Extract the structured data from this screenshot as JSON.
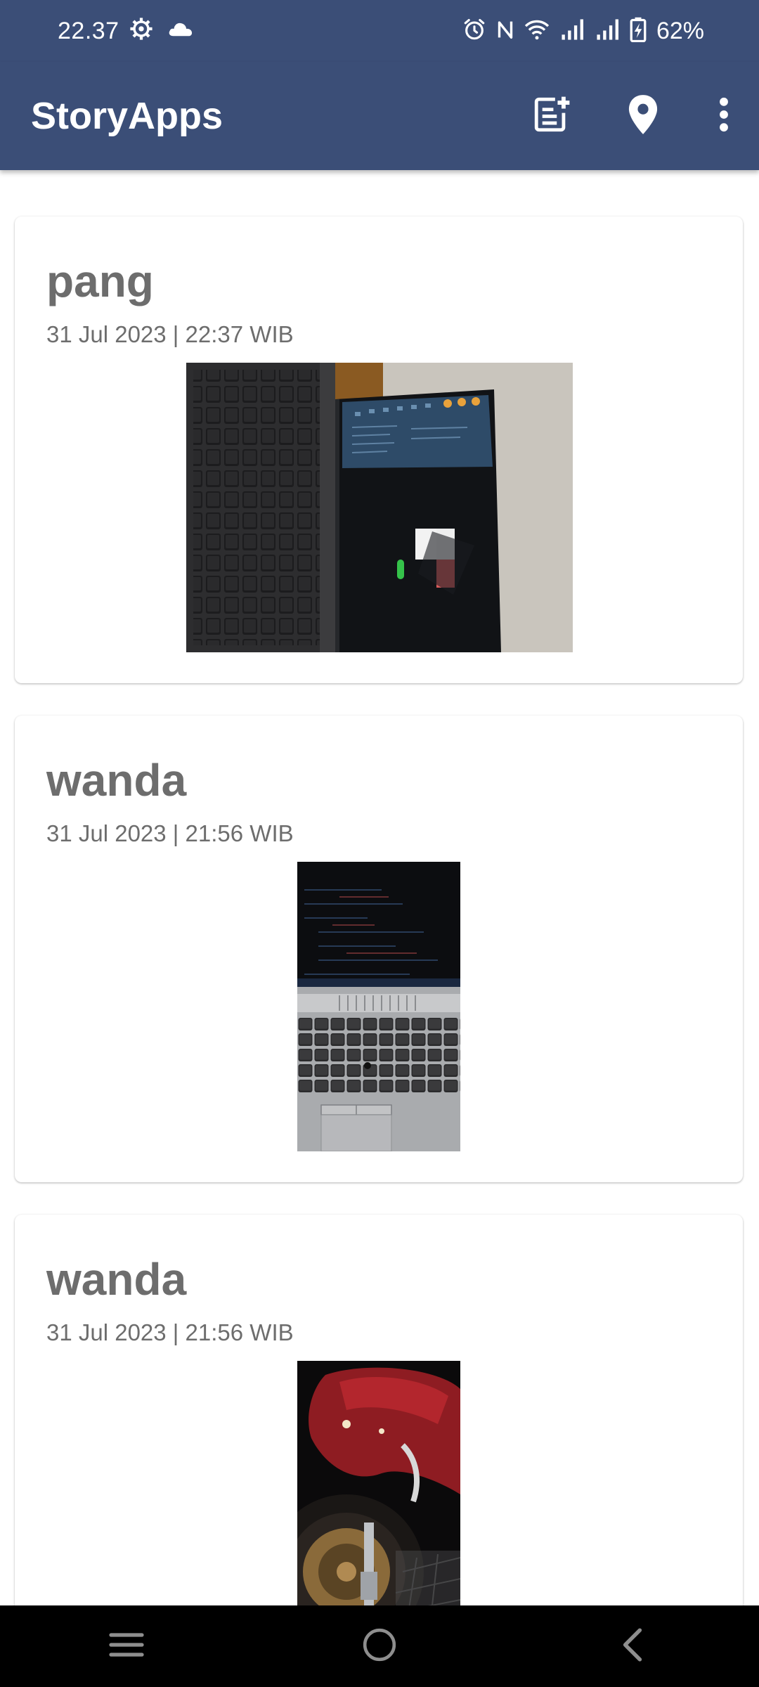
{
  "status_bar": {
    "time": "22.37",
    "battery": "62%",
    "left_icons": [
      "settings-gear-icon",
      "cloud-icon"
    ],
    "right_icons": [
      "alarm-icon",
      "nfc-icon",
      "wifi-icon",
      "signal-icon",
      "signal-icon",
      "battery-charging-icon"
    ]
  },
  "app_bar": {
    "title": "StoryApps",
    "actions": [
      "add-story-icon",
      "location-pin-icon",
      "more-vert-icon"
    ]
  },
  "stories": [
    {
      "name": "pang",
      "date": "31 Jul 2023 | 22:37 WIB"
    },
    {
      "name": "wanda",
      "date": "31 Jul 2023 | 21:56 WIB"
    },
    {
      "name": "wanda",
      "date": "31 Jul 2023 | 21:56 WIB"
    }
  ],
  "nav_bar": {
    "buttons": [
      "recents-icon",
      "home-icon",
      "back-icon"
    ]
  },
  "colors": {
    "primary": "#3b4e77",
    "text_secondary": "#6d6d6d",
    "background": "#ffffff"
  }
}
